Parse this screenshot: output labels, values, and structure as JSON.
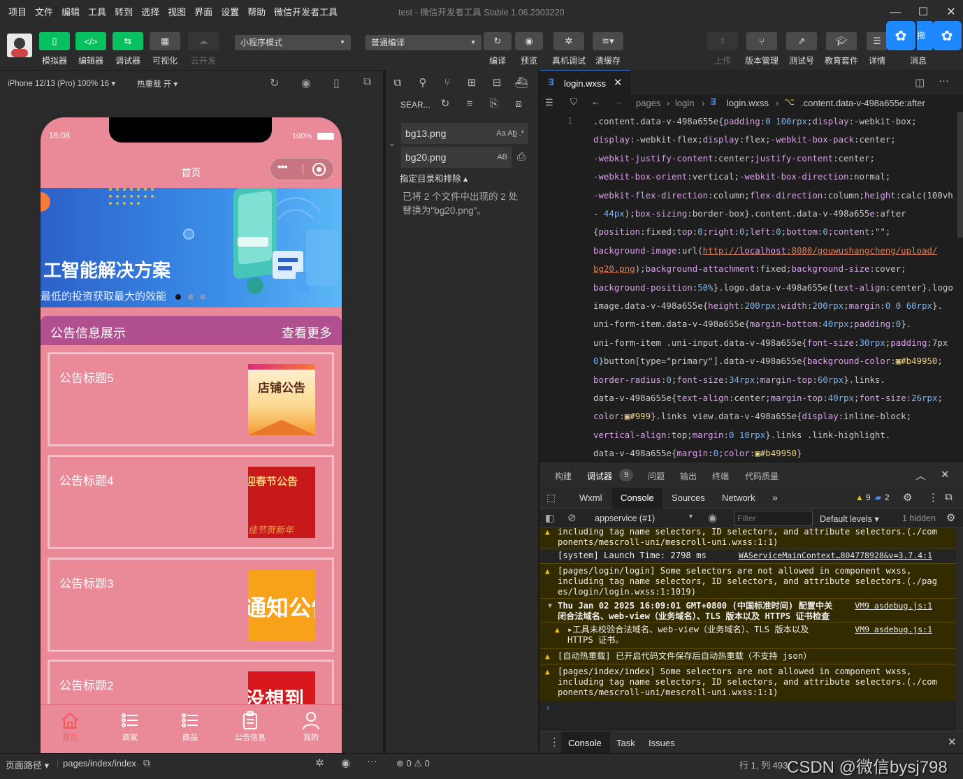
{
  "menu": [
    "项目",
    "文件",
    "编辑",
    "工具",
    "转到",
    "选择",
    "视图",
    "界面",
    "设置",
    "帮助",
    "微信开发者工具"
  ],
  "window_title": "test - 微信开发者工具 Stable 1.06.2303220",
  "toolbar": {
    "simulator": "模拟器",
    "editor": "编辑器",
    "debugger": "调试器",
    "visual": "可视化",
    "cloud": "云开发",
    "mode_select": "小程序模式",
    "compile_select": "普通编译",
    "compile": "编译",
    "preview": "预览",
    "real_debug": "真机调试",
    "clear_cache": "清缓存",
    "upload": "上传",
    "version": "版本管理",
    "test_account": "测试号",
    "edu": "教育套件",
    "details": "详情",
    "messages": "消息",
    "corner_badge": "拖"
  },
  "simbar": {
    "device": "iPhone 12/13 (Pro) 100% 16 ▾",
    "hot_reload": "热重载 开 ▾"
  },
  "phone": {
    "time": "16:08",
    "battery": "100%",
    "nav_title": "首页",
    "banner_title": "工智能解决方案",
    "banner_sub": "最低的投资获取最大的效能",
    "section_title": "公告信息展示",
    "section_more": "查看更多",
    "cards": [
      {
        "title": "公告标题5",
        "img_text": "店铺公告"
      },
      {
        "title": "公告标题4",
        "img_text": "迎春节公告",
        "img_sub": "佳节贺新年"
      },
      {
        "title": "公告标题3",
        "img_text": "通知公告"
      },
      {
        "title": "公告标题2",
        "img_text": "没想到"
      }
    ],
    "tabs": [
      "首页",
      "商家",
      "商品",
      "公告信息",
      "我的"
    ]
  },
  "search": {
    "header": "SEAR...",
    "files": [
      {
        "name": "bg13.png",
        "opts": "Aa  Ab̲  .*"
      },
      {
        "name": "bg20.png",
        "opts": "AB"
      }
    ],
    "toggle": "指定目录和排除 ▴",
    "result": "已将 2 个文件中出现的 2 处替换为\"bg20.png\"。"
  },
  "editor": {
    "tab": "login.wxss",
    "breadcrumb": [
      "pages",
      "login",
      "login.wxss",
      ".content.data-v-498a655e:after"
    ],
    "line_no": "1"
  },
  "code_lines": [
    ".content.data-v-498a655e{padding:0 100rpx;display:-webkit-box;",
    "display:-webkit-flex;display:flex;-webkit-box-pack:center;",
    "-webkit-justify-content:center;justify-content:center;",
    "-webkit-box-orient:vertical;-webkit-box-direction:normal;",
    "-webkit-flex-direction:column;flex-direction:column;height:calc(100vh",
    "- 44px);box-sizing:border-box}.content.data-v-498a655e:after",
    "{position:fixed;top:0;right:0;left:0;bottom:0;content:\"\";",
    "background-image:url(http://localhost:8080/gouwushangcheng/upload/",
    "bg20.png);background-attachment:fixed;background-size:cover;",
    "background-position:50%}.logo.data-v-498a655e{text-align:center}.logo",
    "image.data-v-498a655e{height:200rpx;width:200rpx;margin:0 0 60rpx}.",
    "uni-form-item.data-v-498a655e{margin-bottom:40rpx;padding:0}.",
    "uni-form-item .uni-input.data-v-498a655e{font-size:30rpx;padding:7px",
    "0}button[type=\"primary\"].data-v-498a655e{background-color:▣#b49950;",
    "border-radius:0;font-size:34rpx;margin-top:60rpx}.links.",
    "data-v-498a655e{text-align:center;margin-top:40rpx;font-size:26rpx;",
    "color:▣#999}.links view.data-v-498a655e{display:inline-block;",
    "vertical-align:top;margin:0 10rpx}.links .link-highlight.",
    "data-v-498a655e{margin:0;color:▣#b49950}"
  ],
  "devtools": {
    "tabs_top": [
      "构建",
      "调试器",
      "问题",
      "输出",
      "终端",
      "代码质量"
    ],
    "debugger_badge": "9",
    "panel_tabs": [
      "Wxml",
      "Console",
      "Sources",
      "Network",
      "»"
    ],
    "warn_count": "9",
    "info_count": "2",
    "context": "appservice (#1)",
    "filter_placeholder": "Filter",
    "levels": "Default levels ▾",
    "hidden": "1 hidden",
    "console": [
      {
        "type": "warn",
        "text": "including tag name selectors, ID selectors, and attribute selectors.(./com\nponents/mescroll-uni/mescroll-uni.wxss:1:1)",
        "link": ""
      },
      {
        "type": "log",
        "text": "[system] Launch Time: 2798 ms",
        "link": "WAServiceMainContext…804778928&v=3.7.4:1"
      },
      {
        "type": "warn",
        "text": "[pages/login/login] Some selectors are not allowed in component wxss,\nincluding tag name selectors, ID selectors, and attribute selectors.(./pag\nes/login/login.wxss:1:1019)",
        "link": ""
      },
      {
        "type": "group",
        "text": "Thu Jan 02 2025 16:09:01 GMT+0800 (中国标准时间) 配置中关\n闭合法域名、web-view（业务域名）、TLS 版本以及 HTTPS 证书检查",
        "link": "VM9 asdebug.js:1"
      },
      {
        "type": "warn-sub",
        "text": "▸工具未校验合法域名、web-view（业务域名）、TLS 版本以及\nHTTPS 证书。",
        "link": "VM9 asdebug.js:1"
      },
      {
        "type": "warn",
        "text": "[自动热重载] 已开启代码文件保存后自动热重载（不支持 json）",
        "link": ""
      },
      {
        "type": "warn",
        "text": "[pages/index/index] Some selectors are not allowed in component wxss,\nincluding tag name selectors, ID selectors, and attribute selectors.(./com\nponents/mescroll-uni/mescroll-uni.wxss:1:1)",
        "link": ""
      }
    ],
    "prompt": "›",
    "drawer_tabs": [
      "Console",
      "Task",
      "Issues"
    ]
  },
  "status": {
    "path_label": "页面路径 ▾",
    "path": "pages/index/index",
    "errors": "⊗ 0 ⚠ 0",
    "position": "行 1, 列 493",
    "watermark": "CSDN @微信bysj798"
  },
  "colors": {
    "accent_green": "#07c160",
    "phone_pink": "#ea8a98",
    "section_purple": "#b0508e",
    "blue_badge": "#1e88ff"
  }
}
